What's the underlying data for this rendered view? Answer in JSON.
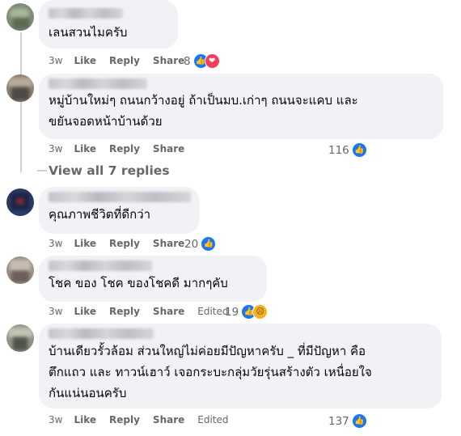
{
  "actions": {
    "like": "Like",
    "reply": "Reply",
    "share": "Share",
    "edited": "Edited"
  },
  "view_replies": "View all 7 replies",
  "comments": [
    {
      "text": "เลนสวนไมครับ",
      "time": "3w",
      "reactions": "8",
      "reaction_icons": [
        "like-icon",
        "love-icon"
      ]
    },
    {
      "text": "หมู่บ้านใหม่ๆ ถนนกว้างอยู่ ถ้าเป็นมบ.เก่าๆ ถนนจะแคบ และ\nขยันจอดหน้าบ้านด้วย",
      "time": "3w",
      "reactions": "116",
      "reaction_icons": [
        "like-icon"
      ]
    },
    {
      "text": "คุณภาพชีวิตที่ดีกว่า",
      "time": "3w",
      "reactions": "20",
      "reaction_icons": [
        "like-icon"
      ]
    },
    {
      "text": "โชค ของ โชค ของโชคดี มากๆคับ",
      "time": "3w",
      "reactions": "19",
      "edited": true,
      "reaction_icons": [
        "like-icon",
        "sad-icon"
      ]
    },
    {
      "text": "บ้านเดียวรั้วล้อม ส่วนใหญ่ไม่ค่อยมีปัญหาครับ _ ที่มีปัญหา คือ\nตึกแถว และ ทาวน์เฮาว์ เจอกระบะกลุ่มวัยรุ่นสร้างตัว เหนื่อยใจ\nกันแน่นอนครับ",
      "time": "3w",
      "reactions": "137",
      "edited": true,
      "reaction_icons": [
        "like-icon"
      ]
    }
  ],
  "colors": {
    "bubble": "#f0f2f5",
    "meta": "#65676b",
    "like": "#1877f2",
    "love": "#f33e58",
    "sad": "#f7b125"
  }
}
